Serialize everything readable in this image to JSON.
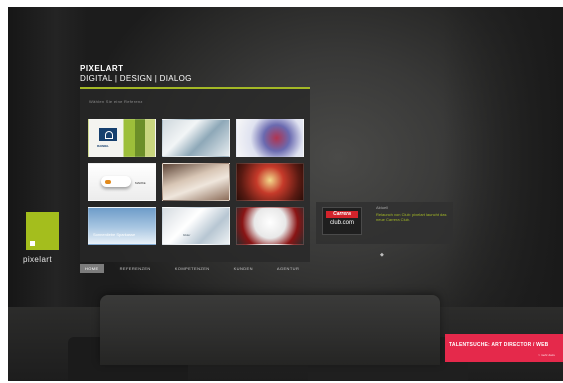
{
  "brand": {
    "name": "PIXELART",
    "tagline": "DIGITAL | DESIGN | DIALOG"
  },
  "panel": {
    "hint": "Wählen Sie eine Referenz",
    "accent": "#a3b826",
    "thumbnails": [
      {
        "label": "RAINIEL"
      },
      {
        "label": ""
      },
      {
        "label": ""
      },
      {
        "label": "MARKE"
      },
      {
        "label": ""
      },
      {
        "label": ""
      },
      {
        "label": "Sonnenliebe Sparkasse"
      },
      {
        "label": "bilder"
      },
      {
        "label": ""
      }
    ]
  },
  "logo": {
    "text": "pixelart",
    "color": "#a4be1d"
  },
  "nav": {
    "items": [
      {
        "label": "HOME",
        "active": true
      },
      {
        "label": "REFERENZEN"
      },
      {
        "label": "KOMPETENZEN"
      },
      {
        "label": "KUNDEN"
      },
      {
        "label": "AGENTUR"
      }
    ]
  },
  "promo": {
    "logo_top": "Carrera",
    "logo_bottom": "club.com",
    "title": "Aktuell",
    "body": "Relaunch von Club: pixelart launcht das neue Carrera Club.",
    "indicator": "◆"
  },
  "banner": {
    "title": "TALENTSUCHE: ART DIRECTOR / WEB",
    "subtitle": "> mehr dazu",
    "color": "#e5294b"
  }
}
